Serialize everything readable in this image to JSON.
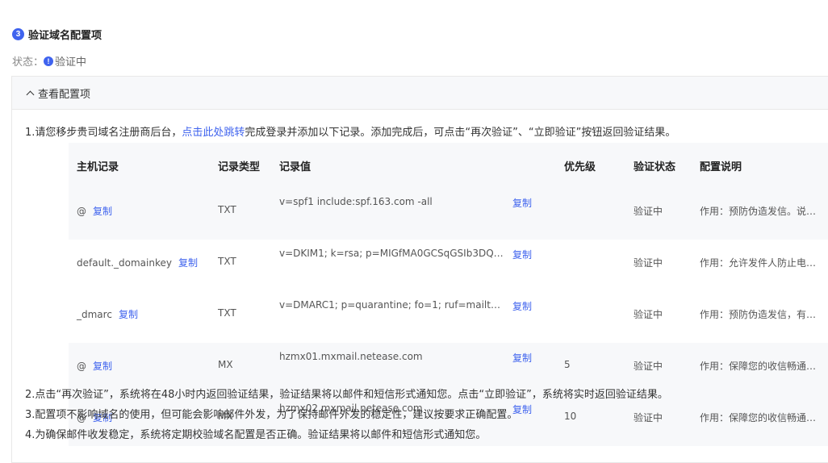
{
  "section": {
    "step_number": "3",
    "title": "验证域名配置项",
    "status_label": "状态：",
    "status_value": "验证中"
  },
  "panel": {
    "header": "查看配置项",
    "instruction_1_prefix": "1.请您移步贵司域名注册商后台，",
    "instruction_1_link": "点击此处跳转",
    "instruction_1_suffix": "完成登录并添加以下记录。添加完成后，可点击“再次验证”、“立即验证”按钮返回验证结果。",
    "note_2": "2.点击“再次验证”，系统将在48小时内返回验证结果，验证结果将以邮件和短信形式通知您。点击“立即验证”，系统将实时返回验证结果。",
    "note_3": "3.配置项不影响域名的使用，但可能会影响邮件外发，为了保持邮件外发的稳定性，建议按要求正确配置。",
    "note_4": "4.为确保邮件收发稳定，系统将定期校验域名配置是否正确。验证结果将以邮件和短信形式通知您。"
  },
  "table": {
    "headers": [
      "主机记录",
      "记录类型",
      "记录值",
      "优先级",
      "验证状态",
      "配置说明"
    ],
    "copy_label": "复制",
    "rows": [
      {
        "host": "@",
        "type": "TXT",
        "value": "v=spf1 include:spf.163.com -all",
        "priority": "",
        "status": "验证中",
        "desc": "作用：预防伪造发信。说…"
      },
      {
        "host": "default._domainkey",
        "type": "TXT",
        "value": "v=DKIM1; k=rsa; p=MIGfMA0GCSqGSIb3DQEBA…",
        "priority": "",
        "status": "验证中",
        "desc": "作用：允许发件人防止电…"
      },
      {
        "host": "_dmarc",
        "type": "TXT",
        "value": "v=DMARC1; p=quarantine; fo=1; ruf=mailto:dmar…",
        "priority": "",
        "status": "验证中",
        "desc": "作用：预防伪造发信，有…"
      },
      {
        "host": "@",
        "type": "MX",
        "value": "hzmx01.mxmail.netease.com",
        "priority": "5",
        "status": "验证中",
        "desc": "作用：保障您的收信畅通…"
      },
      {
        "host": "@",
        "type": "MX",
        "value": "hzmx02.mxmail.netease.com",
        "priority": "10",
        "status": "验证中",
        "desc": "作用：保障您的收信畅通…"
      }
    ]
  }
}
